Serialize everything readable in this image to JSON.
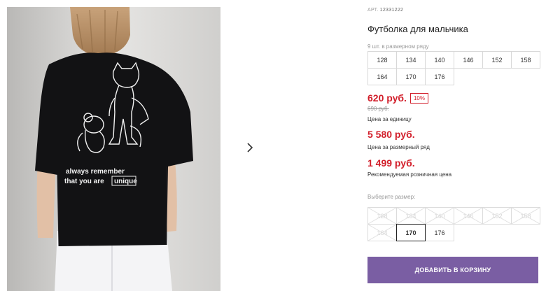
{
  "product": {
    "sku_label": "АРТ.",
    "sku": "12331222",
    "title": "Футболка для мальчика",
    "row_note": "9 шт. в размерном ряду",
    "sizes": [
      "128",
      "134",
      "140",
      "146",
      "152",
      "158",
      "164",
      "170",
      "176"
    ],
    "price": "620 руб.",
    "discount": "10%",
    "old_price": "690 руб.",
    "unit_label": "Цена за единицу",
    "row_price": "5 580 руб.",
    "row_label": "Цена за размерный ряд",
    "retail_price": "1 499 руб.",
    "retail_label": "Рекомендуемая розничная цена"
  },
  "size_picker": {
    "label": "Выберите размер:",
    "options": [
      {
        "size": "128",
        "available": false
      },
      {
        "size": "134",
        "available": false
      },
      {
        "size": "140",
        "available": false
      },
      {
        "size": "146",
        "available": false
      },
      {
        "size": "152",
        "available": false
      },
      {
        "size": "158",
        "available": false
      },
      {
        "size": "164",
        "available": false
      },
      {
        "size": "170",
        "available": true,
        "selected": true
      },
      {
        "size": "176",
        "available": true
      }
    ]
  },
  "photo": {
    "print_line1": "always remember",
    "print_line2": "that you are",
    "print_word": "unique"
  },
  "actions": {
    "add_to_cart": "ДОБАВИТЬ В КОРЗИНУ"
  },
  "icons": {
    "next": "chevron-right-icon"
  },
  "colors": {
    "price": "#d21f2b",
    "button": "#7a5ea3"
  }
}
